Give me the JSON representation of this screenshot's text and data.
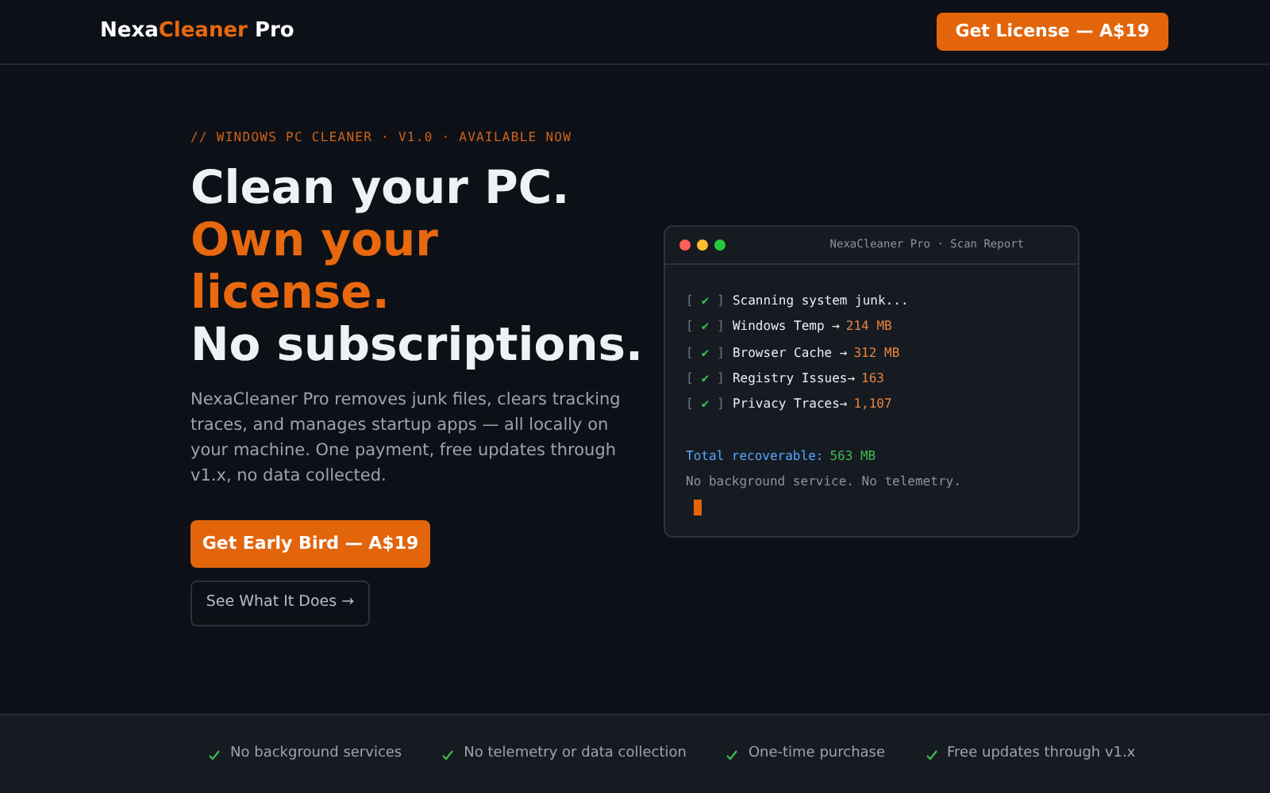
{
  "header": {
    "brand": [
      {
        "text": "Nexa",
        "accent": false
      },
      {
        "text": "Cleaner",
        "accent": true
      },
      {
        "text": " Pro",
        "accent": false
      }
    ],
    "cta": "Get License — A$19"
  },
  "hero": {
    "eyebrow": "// WINDOWS PC CLEANER · V1.0 · AVAILABLE NOW",
    "headline": [
      {
        "text": "Clean your PC.",
        "accent": false
      },
      {
        "text": "Own your license.",
        "accent": true
      },
      {
        "text": "No subscriptions.",
        "accent": false
      }
    ],
    "description": "NexaCleaner Pro removes junk files, clears tracking traces, and manages startup apps — all locally on your machine. One payment, free updates through v1.x, no data collected.",
    "primary_button": "Get Early Bird — A$19",
    "secondary_button": "See What It Does →"
  },
  "terminal": {
    "title": "NexaCleaner Pro · Scan Report",
    "lines": [
      {
        "kind": "check",
        "open": "[",
        "tick": "✔",
        "close": "]",
        "label": "Scanning system junk..."
      },
      {
        "kind": "check",
        "open": "[",
        "tick": "✔",
        "close": "]",
        "label": "Windows Temp →",
        "value": "214 MB",
        "color": "#e8843c"
      },
      {
        "kind": "check",
        "open": "[",
        "tick": "✔",
        "close": "]",
        "label": "Browser Cache →",
        "value": "312 MB",
        "color": "#e8843c"
      },
      {
        "kind": "check",
        "open": "[",
        "tick": "✔",
        "close": "]",
        "label": "Registry Issues→",
        "value": "163",
        "color": "#e8843c"
      },
      {
        "kind": "check",
        "open": "[",
        "tick": "✔",
        "close": "]",
        "label": "Privacy Traces→",
        "value": "1,107",
        "color": "#e8843c"
      },
      {
        "kind": "blank"
      },
      {
        "kind": "total",
        "label": "Total recoverable:",
        "value": "563 MB"
      },
      {
        "kind": "note",
        "label": "No background service. No telemetry."
      },
      {
        "kind": "cursor"
      }
    ]
  },
  "features": [
    "No background services",
    "No telemetry or data collection",
    "One-time purchase",
    "Free updates through v1.x"
  ]
}
